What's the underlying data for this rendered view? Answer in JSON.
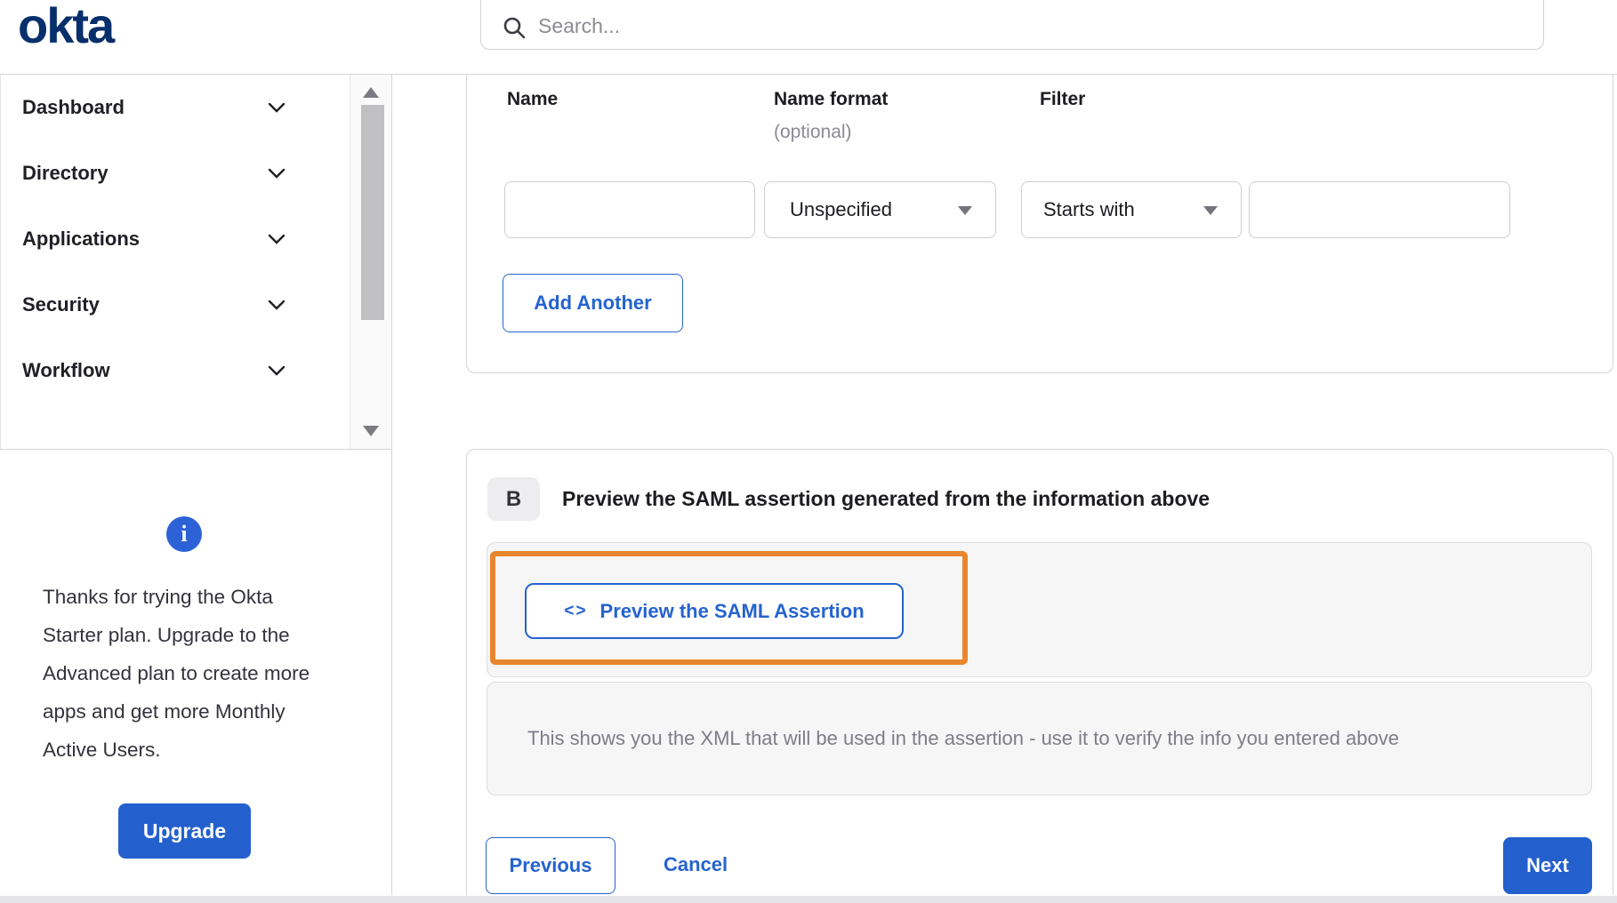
{
  "brand": {
    "logo_text": "okta"
  },
  "header": {
    "search_placeholder": "Search..."
  },
  "sidebar": {
    "items": [
      {
        "label": "Dashboard"
      },
      {
        "label": "Directory"
      },
      {
        "label": "Applications"
      },
      {
        "label": "Security"
      },
      {
        "label": "Workflow"
      }
    ],
    "upsell": {
      "text": "Thanks for trying the Okta Starter plan. Upgrade to the Advanced plan to create more apps and get more Monthly Active Users.",
      "button_label": "Upgrade"
    }
  },
  "form": {
    "columns": {
      "name_label": "Name",
      "name_format_label": "Name format",
      "name_format_sublabel": "(optional)",
      "filter_label": "Filter"
    },
    "name_value": "",
    "name_format_value": "Unspecified",
    "filter_operator_value": "Starts with",
    "filter_value": "",
    "add_another_label": "Add Another"
  },
  "section_b": {
    "badge": "B",
    "title": "Preview the SAML assertion generated from the information above",
    "preview_button_icon": "<>",
    "preview_button_label": "Preview the SAML Assertion",
    "description": "This shows you the XML that will be used in the assertion - use it to verify the info you entered above"
  },
  "footer": {
    "previous_label": "Previous",
    "cancel_label": "Cancel",
    "next_label": "Next"
  },
  "icons": {
    "info_glyph": "i"
  },
  "colors": {
    "accent_blue": "#2563cf",
    "button_blue": "#2360ce",
    "logo_navy": "#072f6b",
    "highlight_orange": "#e8862d"
  }
}
